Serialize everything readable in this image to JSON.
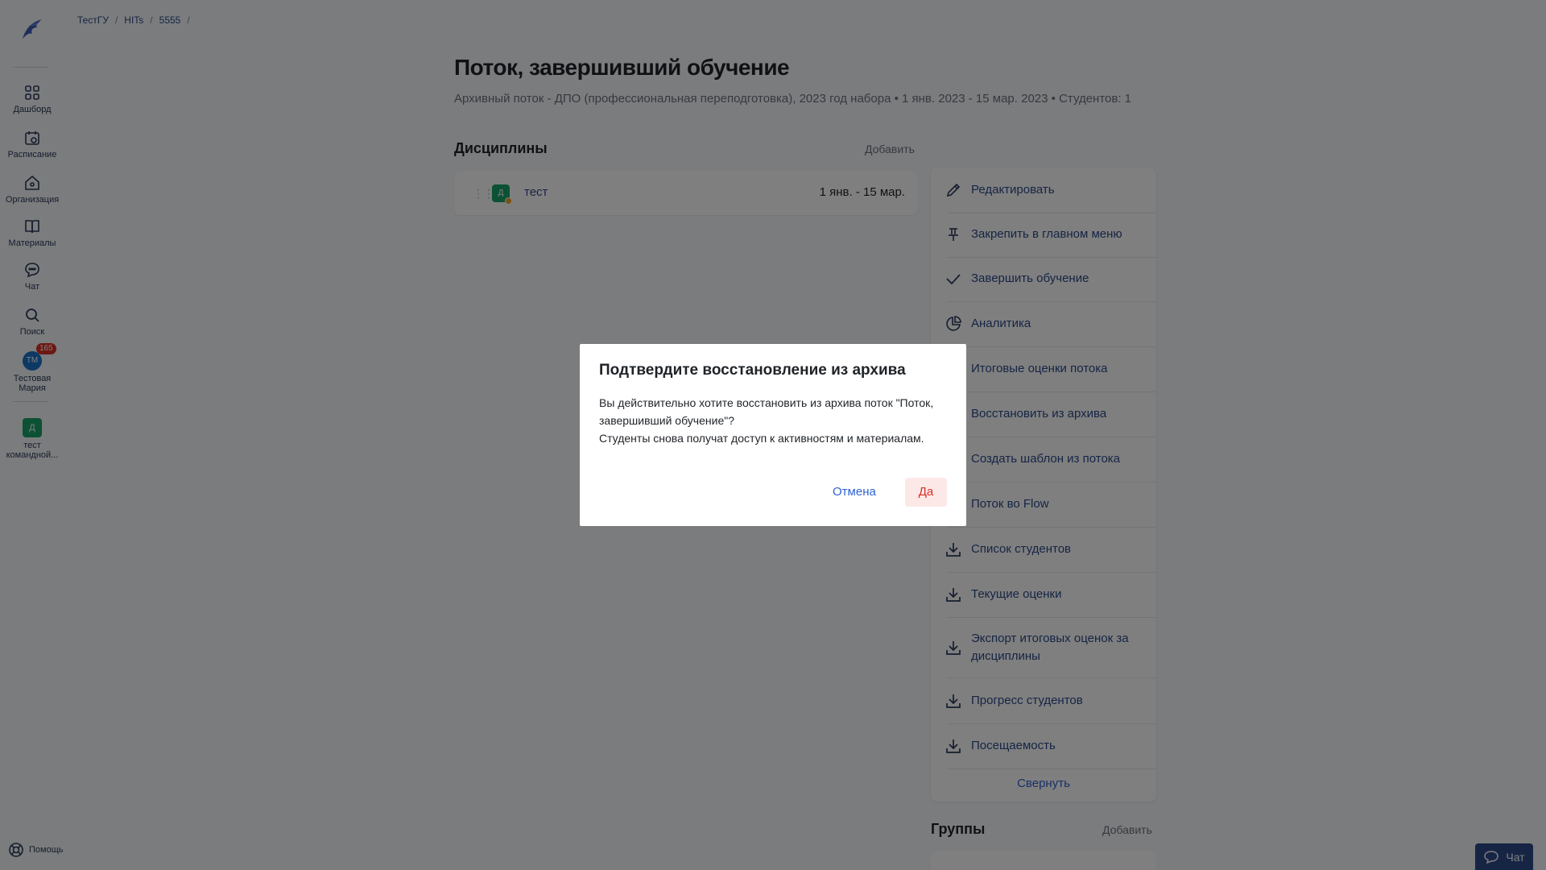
{
  "breadcrumb": [
    "ТестГУ",
    "HITs",
    "5555"
  ],
  "sidebar": {
    "items": [
      {
        "label": "Дашборд",
        "icon": "grid-icon"
      },
      {
        "label": "Расписание",
        "icon": "calendar-icon"
      },
      {
        "label": "Организация",
        "icon": "home-icon"
      },
      {
        "label": "Материалы",
        "icon": "book-icon"
      },
      {
        "label": "Чат",
        "icon": "chat-icon"
      },
      {
        "label": "Поиск",
        "icon": "search-icon"
      }
    ],
    "user": {
      "initials": "ТМ",
      "name": "Тестовая Мария",
      "badge": "165"
    },
    "team": {
      "initial": "Д",
      "name": "тест командной..."
    },
    "help": "Помощь"
  },
  "page": {
    "title": "Поток, завершивший обучение",
    "subtitle": "Архивный поток - ДПО (профессиональная переподготовка), 2023 год набора • 1 янв. 2023 - 15 мар. 2023 • Студентов: 1"
  },
  "disciplines": {
    "title": "Дисциплины",
    "add": "Добавить",
    "items": [
      {
        "icon": "Д",
        "name": "тест",
        "dates": "1 янв. - 15 мар."
      }
    ]
  },
  "menu": {
    "items": [
      {
        "label": "Редактировать",
        "icon": "pencil-icon"
      },
      {
        "label": "Закрепить в главном меню",
        "icon": "pin-icon"
      },
      {
        "label": "Завершить обучение",
        "icon": "check-icon"
      },
      {
        "label": "Аналитика",
        "icon": "pie-chart-icon"
      },
      {
        "label": "Итоговые оценки потока",
        "icon": "grades-icon"
      },
      {
        "label": "Восстановить из архива",
        "icon": "restore-icon"
      },
      {
        "label": "Создать шаблон из потока",
        "icon": "template-icon"
      },
      {
        "label": "Поток во Flow",
        "icon": "flow-icon"
      },
      {
        "label": "Список студентов",
        "icon": "download-icon"
      },
      {
        "label": "Текущие оценки",
        "icon": "download-icon"
      },
      {
        "label": "Экспорт итоговых оценок за дисциплины",
        "icon": "download-icon"
      },
      {
        "label": "Прогресс студентов",
        "icon": "download-icon"
      },
      {
        "label": "Посещаемость",
        "icon": "download-icon"
      }
    ],
    "collapse": "Свернуть"
  },
  "groups": {
    "title": "Группы",
    "add": "Добавить"
  },
  "chat_button": "Чат",
  "dialog": {
    "title": "Подтвердите восстановление из архива",
    "line1": "Вы действительно хотите восстановить из архива поток \"Поток, завершивший обучение\"?",
    "line2": "Студенты снова получат доступ к активностям и материалам.",
    "cancel": "Отмена",
    "confirm": "Да"
  }
}
